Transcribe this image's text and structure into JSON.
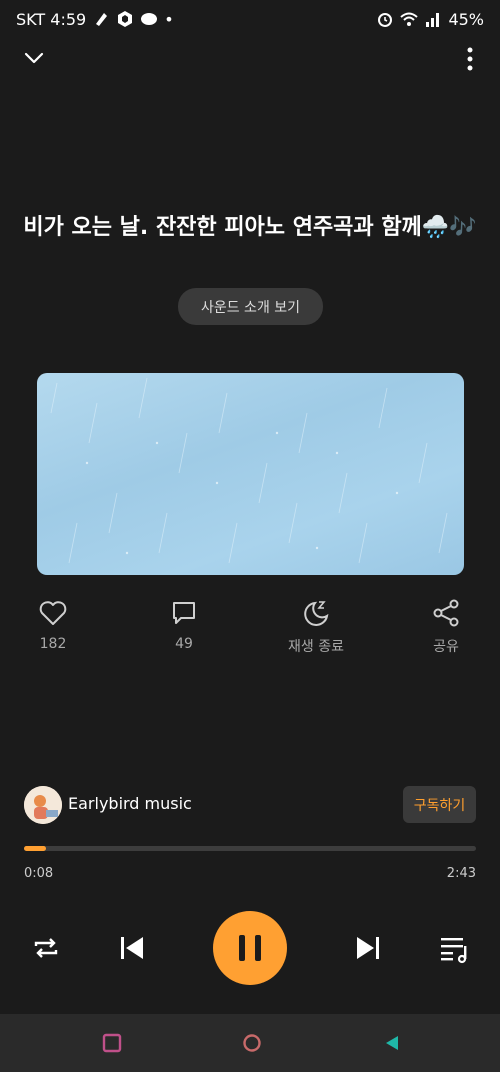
{
  "status_bar": {
    "carrier_time": "SKT 4:59",
    "dot": "•",
    "battery": "45%",
    "icons": [
      "notification-icon",
      "box-icon",
      "cloud-icon",
      "alarm-icon",
      "wifi-icon",
      "signal-icon",
      "battery-icon"
    ]
  },
  "header": {
    "collapse_icon": "chevron-down-icon",
    "more_icon": "more-vertical-icon"
  },
  "track": {
    "title": "비가 오는 날. 잔잔한 피아노 연주곡과 함께🌧️🎶",
    "intro_button": "사운드 소개 보기"
  },
  "actions": [
    {
      "icon": "heart-icon",
      "label": "182"
    },
    {
      "icon": "comment-icon",
      "label": "49"
    },
    {
      "icon": "sleep-timer-icon",
      "label": "재생 종료"
    },
    {
      "icon": "share-icon",
      "label": "공유"
    }
  ],
  "artist": {
    "name": "Earlybird music",
    "subscribe_label": "구독하기"
  },
  "playback": {
    "elapsed": "0:08",
    "total": "2:43",
    "progress_fraction": 0.049
  },
  "controls": {
    "repeat_icon": "repeat-icon",
    "prev_icon": "skip-previous-icon",
    "play_pause_icon": "pause-icon",
    "next_icon": "skip-next-icon",
    "playlist_icon": "playlist-icon"
  },
  "nav_bar": {
    "recent_icon": "recent-apps-icon",
    "home_icon": "home-icon",
    "back_icon": "back-icon"
  },
  "colors": {
    "background": "#1b1b1b",
    "accent": "#ffa032",
    "nav_recent": "#c0508a",
    "nav_home": "#c86a6a",
    "nav_back": "#1fb8a8"
  }
}
